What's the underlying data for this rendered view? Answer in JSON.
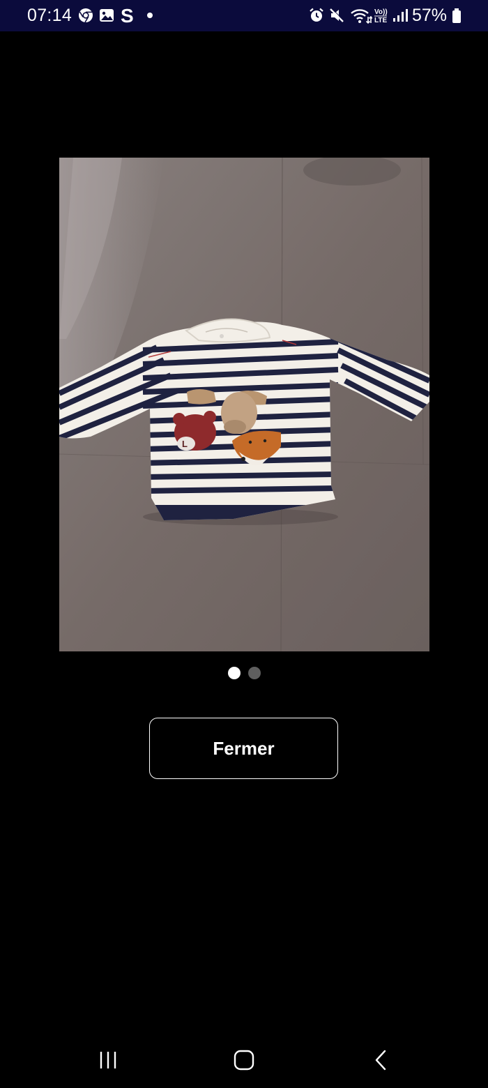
{
  "status_bar": {
    "time": "07:14",
    "battery_percent": "57%",
    "left_icons": [
      "chrome-icon",
      "gallery-icon",
      "shazam-icon",
      "notification-dot-icon"
    ],
    "right_icons": [
      "alarm-icon",
      "mute-icon",
      "wifi-icon",
      "volte-icon",
      "signal-icon",
      "battery-icon"
    ],
    "volte_label": "Vo)) LTE"
  },
  "viewer": {
    "image_count": 2,
    "active_index": 0,
    "close_label": "Fermer"
  },
  "colors": {
    "status_bar_bg": "#0b0b3c",
    "background": "#000000",
    "dot_active": "#ffffff",
    "dot_inactive": "#5f5f5f"
  },
  "navigation_bar": {
    "items": [
      "recent-apps-icon",
      "home-icon",
      "back-icon"
    ]
  }
}
